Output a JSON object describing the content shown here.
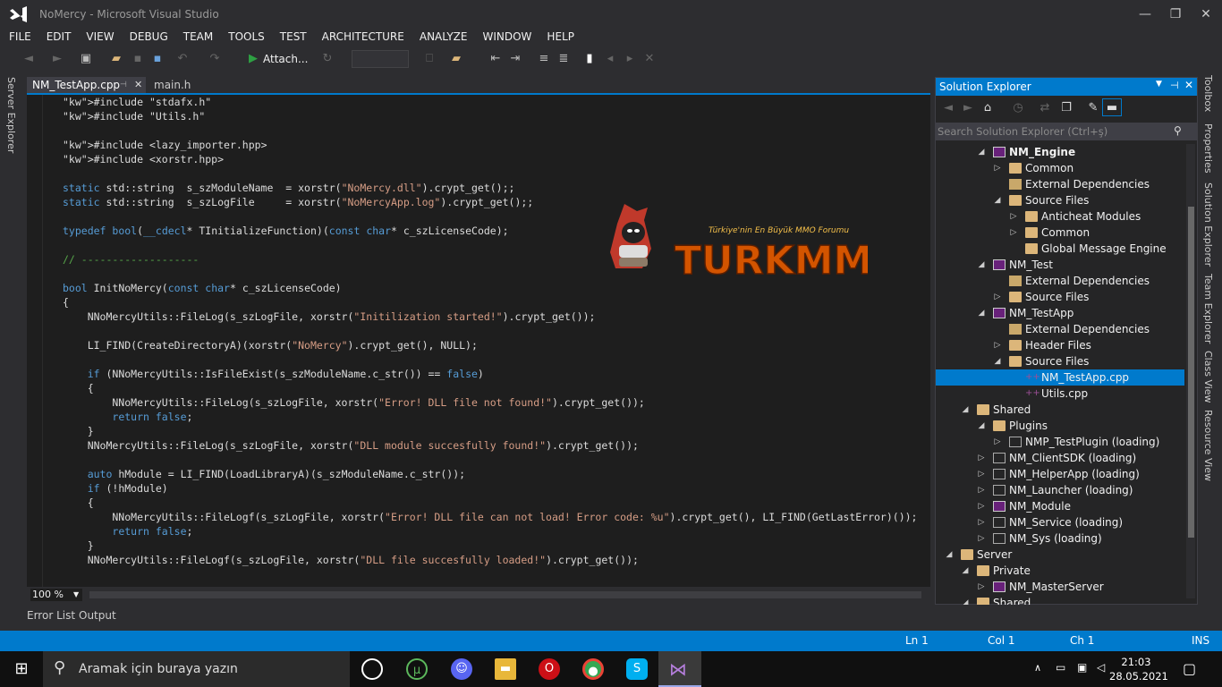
{
  "window": {
    "title": "NoMercy - Microsoft Visual Studio"
  },
  "menu": [
    "FILE",
    "EDIT",
    "VIEW",
    "DEBUG",
    "TEAM",
    "TOOLS",
    "TEST",
    "ARCHITECTURE",
    "ANALYZE",
    "WINDOW",
    "HELP"
  ],
  "toolbar": {
    "attach_label": "Attach..."
  },
  "left_tabs": {
    "server_explorer": "Server Explorer"
  },
  "doc_tabs": {
    "active": "NM_TestApp.cpp",
    "other": "main.h"
  },
  "code_lines": [
    "#include \"stdafx.h\"",
    "#include \"Utils.h\"",
    "",
    "#include <lazy_importer.hpp>",
    "#include <xorstr.hpp>",
    "",
    "static std::string  s_szModuleName  = xorstr(\"NoMercy.dll\").crypt_get();;",
    "static std::string  s_szLogFile     = xorstr(\"NoMercyApp.log\").crypt_get();;",
    "",
    "typedef bool(__cdecl* TInitializeFunction)(const char* c_szLicenseCode);",
    "",
    "// -------------------",
    "",
    "bool InitNoMercy(const char* c_szLicenseCode)",
    "{",
    "    NNoMercyUtils::FileLog(s_szLogFile, xorstr(\"Initilization started!\").crypt_get());",
    "",
    "    LI_FIND(CreateDirectoryA)(xorstr(\"NoMercy\").crypt_get(), NULL);",
    "",
    "    if (NNoMercyUtils::IsFileExist(s_szModuleName.c_str()) == false)",
    "    {",
    "        NNoMercyUtils::FileLog(s_szLogFile, xorstr(\"Error! DLL file not found!\").crypt_get());",
    "        return false;",
    "    }",
    "    NNoMercyUtils::FileLog(s_szLogFile, xorstr(\"DLL module succesfully found!\").crypt_get());",
    "",
    "    auto hModule = LI_FIND(LoadLibraryA)(s_szModuleName.c_str());",
    "    if (!hModule)",
    "    {",
    "        NNoMercyUtils::FileLogf(s_szLogFile, xorstr(\"Error! DLL file can not load! Error code: %u\").crypt_get(), LI_FIND(GetLastError)());",
    "        return false;",
    "    }",
    "    NNoMercyUtils::FileLogf(s_szLogFile, xorstr(\"DLL file succesfully loaded!\").crypt_get());"
  ],
  "zoom": "100 %",
  "bottom_tabs": {
    "error_list": "Error List",
    "output": "Output"
  },
  "status": {
    "ln": "Ln 1",
    "col": "Col 1",
    "ch": "Ch 1",
    "mode": "INS"
  },
  "solution_explorer": {
    "title": "Solution Explorer",
    "search_placeholder": "Search Solution Explorer (Ctrl+ş)",
    "nodes": [
      {
        "label": "NM_Engine",
        "indent": 3,
        "arrow": "expanded",
        "icon": "project",
        "bold": true
      },
      {
        "label": "Common",
        "indent": 4,
        "arrow": "collapsed",
        "icon": "folder"
      },
      {
        "label": "External Dependencies",
        "indent": 4,
        "arrow": "none",
        "icon": "ref"
      },
      {
        "label": "Source Files",
        "indent": 4,
        "arrow": "expanded",
        "icon": "folder"
      },
      {
        "label": "Anticheat Modules",
        "indent": 5,
        "arrow": "collapsed",
        "icon": "folder"
      },
      {
        "label": "Common",
        "indent": 5,
        "arrow": "collapsed",
        "icon": "folder"
      },
      {
        "label": "Global Message Engine",
        "indent": 5,
        "arrow": "none",
        "icon": "folder"
      },
      {
        "label": "NM_Test",
        "indent": 3,
        "arrow": "expanded",
        "icon": "project"
      },
      {
        "label": "External Dependencies",
        "indent": 4,
        "arrow": "none",
        "icon": "ref"
      },
      {
        "label": "Source Files",
        "indent": 4,
        "arrow": "collapsed",
        "icon": "folder"
      },
      {
        "label": "NM_TestApp",
        "indent": 3,
        "arrow": "expanded",
        "icon": "project"
      },
      {
        "label": "External Dependencies",
        "indent": 4,
        "arrow": "none",
        "icon": "ref"
      },
      {
        "label": "Header Files",
        "indent": 4,
        "arrow": "collapsed",
        "icon": "folder"
      },
      {
        "label": "Source Files",
        "indent": 4,
        "arrow": "expanded",
        "icon": "folder"
      },
      {
        "label": "NM_TestApp.cpp",
        "indent": 5,
        "arrow": "none",
        "icon": "cpp",
        "selected": true
      },
      {
        "label": "Utils.cpp",
        "indent": 5,
        "arrow": "none",
        "icon": "cpp"
      },
      {
        "label": "Shared",
        "indent": 2,
        "arrow": "expanded",
        "icon": "folder"
      },
      {
        "label": "Plugins",
        "indent": 3,
        "arrow": "expanded",
        "icon": "folder"
      },
      {
        "label": "NMP_TestPlugin (loading)",
        "indent": 4,
        "arrow": "collapsed",
        "icon": "project-loading"
      },
      {
        "label": "NM_ClientSDK (loading)",
        "indent": 3,
        "arrow": "collapsed",
        "icon": "project-loading"
      },
      {
        "label": "NM_HelperApp (loading)",
        "indent": 3,
        "arrow": "collapsed",
        "icon": "project-loading"
      },
      {
        "label": "NM_Launcher (loading)",
        "indent": 3,
        "arrow": "collapsed",
        "icon": "project-loading"
      },
      {
        "label": "NM_Module",
        "indent": 3,
        "arrow": "collapsed",
        "icon": "project"
      },
      {
        "label": "NM_Service (loading)",
        "indent": 3,
        "arrow": "collapsed",
        "icon": "project-loading"
      },
      {
        "label": "NM_Sys (loading)",
        "indent": 3,
        "arrow": "collapsed",
        "icon": "project-loading"
      },
      {
        "label": "Server",
        "indent": 1,
        "arrow": "expanded",
        "icon": "folder"
      },
      {
        "label": "Private",
        "indent": 2,
        "arrow": "expanded",
        "icon": "folder"
      },
      {
        "label": "NM_MasterServer",
        "indent": 3,
        "arrow": "collapsed",
        "icon": "project"
      },
      {
        "label": "Shared",
        "indent": 2,
        "arrow": "expanded",
        "icon": "folder"
      }
    ]
  },
  "right_tabs": [
    "Toolbox",
    "Properties",
    "Solution Explorer",
    "Team Explorer",
    "Class View",
    "Resource View"
  ],
  "taskbar": {
    "search_placeholder": "Aramak için buraya yazın",
    "time": "21:03",
    "date": "28.05.2021"
  },
  "watermark": {
    "tagline": "Türkiye'nin En Büyük MMO Forumu",
    "brand": "TURKMMO"
  },
  "colors": {
    "accent": "#007acc",
    "editor_bg": "#1e1e1e",
    "chrome_bg": "#2d2d30"
  }
}
